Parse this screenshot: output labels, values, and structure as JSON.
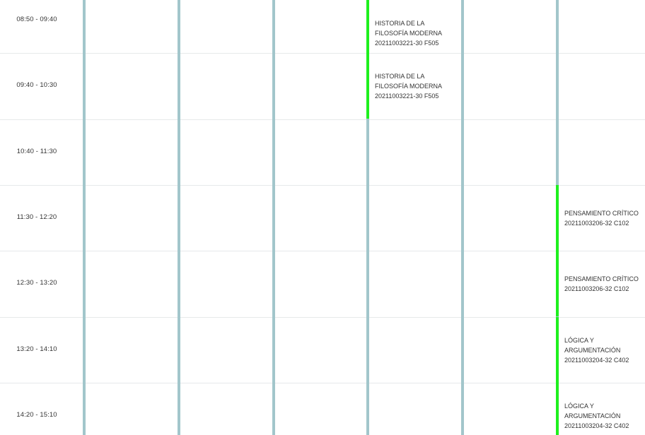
{
  "colors": {
    "column_line": "#a2c6cb",
    "event_accent": "#1ef01e",
    "row_separator": "#e6e9ea",
    "text": "#333333"
  },
  "time_slots": [
    "08:50 - 09:40",
    "09:40 - 10:30",
    "10:40 - 11:30",
    "11:30 - 12:20",
    "12:30 - 13:20",
    "13:20 - 14:10",
    "14:20 - 15:10"
  ],
  "events": [
    {
      "day_column": 4,
      "slot": 0,
      "lines": [
        "HISTORIA DE LA",
        "FILOSOFÍA MODERNA",
        "20211003221-30 F505"
      ]
    },
    {
      "day_column": 4,
      "slot": 1,
      "lines": [
        "HISTORIA DE LA",
        "FILOSOFÍA MODERNA",
        "20211003221-30 F505"
      ]
    },
    {
      "day_column": 6,
      "slot": 3,
      "lines": [
        "PENSAMIENTO CRÍTICO",
        "20211003206-32 C102"
      ]
    },
    {
      "day_column": 6,
      "slot": 4,
      "lines": [
        "PENSAMIENTO CRÍTICO",
        "20211003206-32 C102"
      ]
    },
    {
      "day_column": 6,
      "slot": 5,
      "lines": [
        "LÓGICA Y",
        "ARGUMENTACIÓN",
        "20211003204-32 C402"
      ]
    },
    {
      "day_column": 6,
      "slot": 6,
      "lines": [
        "LÓGICA Y",
        "ARGUMENTACIÓN",
        "20211003204-32 C402"
      ]
    }
  ]
}
